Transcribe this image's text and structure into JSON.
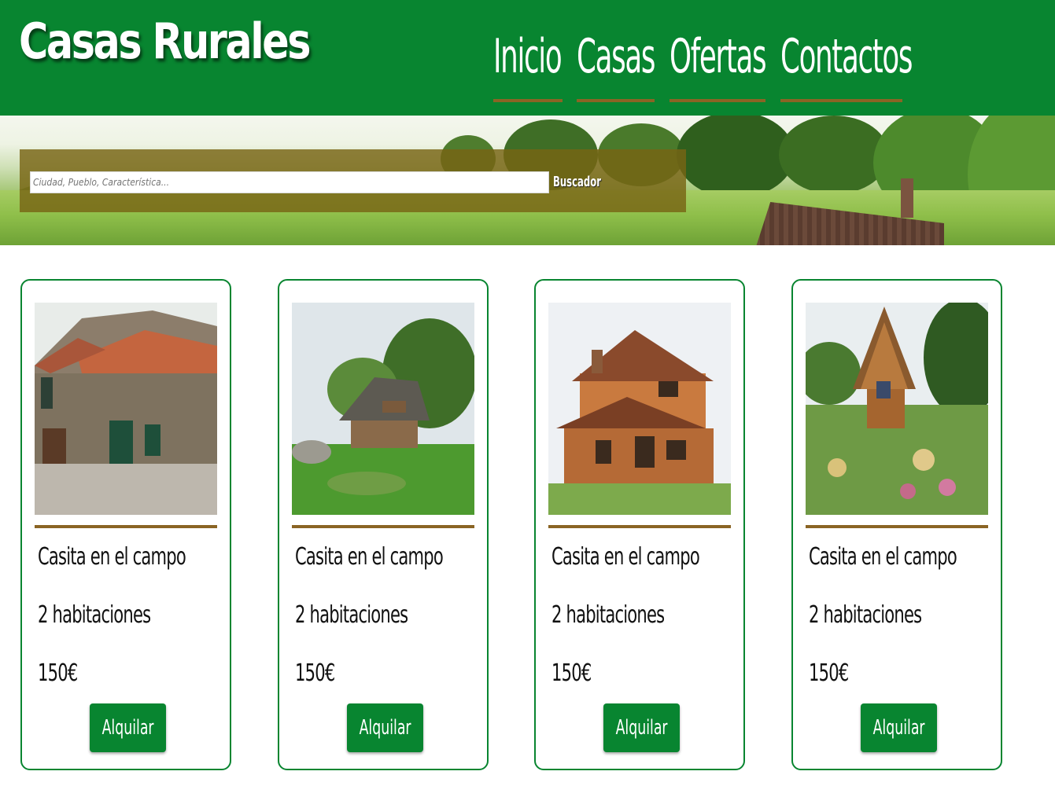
{
  "header": {
    "logo": "Casas Rurales",
    "nav": [
      {
        "label": "Inicio"
      },
      {
        "label": "Casas"
      },
      {
        "label": "Ofertas"
      },
      {
        "label": "Contactos"
      }
    ]
  },
  "search": {
    "placeholder": "Ciudad, Pueblo, Característica...",
    "button_label": "Buscador"
  },
  "cards": [
    {
      "title": "Casita en el campo",
      "rooms": "2 habitaciones",
      "price": "150€",
      "button": "Alquilar",
      "photo": "stone-house-photo"
    },
    {
      "title": "Casita en el campo",
      "rooms": "2 habitaciones",
      "price": "150€",
      "button": "Alquilar",
      "photo": "thatched-cottage-photo"
    },
    {
      "title": "Casita en el campo",
      "rooms": "2 habitaciones",
      "price": "150€",
      "button": "Alquilar",
      "photo": "orange-house-photo"
    },
    {
      "title": "Casita en el campo",
      "rooms": "2 habitaciones",
      "price": "150€",
      "button": "Alquilar",
      "photo": "wooden-hut-photo"
    }
  ],
  "colors": {
    "brand_green": "#088530",
    "accent_brown": "#8a6424"
  }
}
